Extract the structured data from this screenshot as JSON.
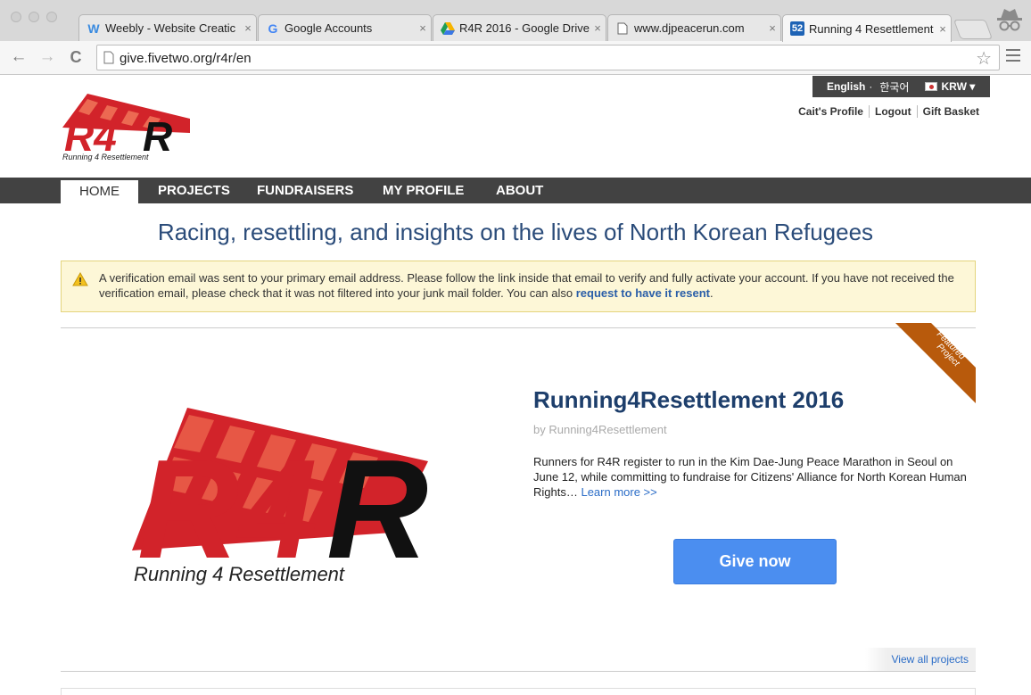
{
  "browser": {
    "tabs": [
      {
        "title": "Weebly - Website Creatic",
        "icon": "weebly-icon",
        "active": false
      },
      {
        "title": "Google Accounts",
        "icon": "google-icon",
        "active": false
      },
      {
        "title": "R4R 2016 - Google Drive",
        "icon": "google-drive-icon",
        "active": false
      },
      {
        "title": "www.djpeacerun.com",
        "icon": "page-icon",
        "active": false
      },
      {
        "title": "Running 4 Resettlement",
        "icon": "fivetwo-icon",
        "active": true
      }
    ],
    "close_glyph": "×",
    "url": "give.fivetwo.org/r4r/en"
  },
  "header": {
    "lang_en": "English",
    "lang_sep": "·",
    "lang_ko": "한국어",
    "currency": "KRW ▾",
    "profile_link": "Cait's Profile",
    "logout_link": "Logout",
    "basket_link": "Gift Basket",
    "logo_text": "R4R",
    "logo_caption": "Running 4 Resettlement"
  },
  "nav": {
    "home": "HOME",
    "projects": "PROJECTS",
    "fundraisers": "FUNDRAISERS",
    "profile": "MY PROFILE",
    "about": "ABOUT"
  },
  "tagline": "Racing, resettling, and insights on the lives of North Korean Refugees",
  "alert": {
    "text": "A verification email was sent to your primary email address. Please follow the link inside that email to verify and fully activate your account. If you have not received the verification email, please check that it was not filtered into your junk mail folder. You can also ",
    "link": "request to have it resent",
    "end": "."
  },
  "featured": {
    "ribbon": "Featured Project",
    "ribbon_line1": "Featured",
    "ribbon_line2": "Project",
    "title": "Running4Resettlement 2016",
    "by": "by Running4Resettlement",
    "description": "Runners for R4R register to run in the Kim Dae-Jung Peace Marathon in Seoul on June 12, while committing to fundraise for Citizens' Alliance for North Korean Human Rights… ",
    "learn_more": "Learn more >>",
    "give_button": "Give now",
    "logo_text": "R4R",
    "logo_caption": "Running 4 Resettlement",
    "view_all": "View all projects"
  },
  "colors": {
    "accent_red": "#d2232a",
    "nav_dark": "#424242",
    "tagline_blue": "#2b4c7a",
    "give_blue": "#4b8ef0",
    "ribbon_orange": "#b85a0c"
  }
}
